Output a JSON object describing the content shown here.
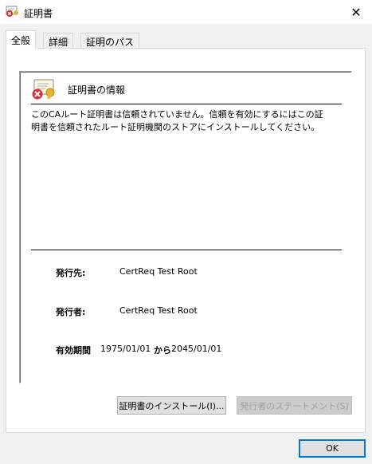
{
  "window": {
    "title": "証明書",
    "close_icon": "close-icon"
  },
  "tabs": [
    {
      "label": "全般",
      "active": true
    },
    {
      "label": "詳細",
      "active": false
    },
    {
      "label": "証明のパス",
      "active": false
    }
  ],
  "general": {
    "section_title": "証明書の情報",
    "warning_lines": [
      "このCAルート証明書は信頼されていません。信頼を有効にするにはこの証",
      "明書を信頼されたルート証明機関のストアにインストールしてください。"
    ],
    "issued_to_label": "発行先:",
    "issued_to_value": "CertReq Test Root",
    "issued_by_label": "発行者:",
    "issued_by_value": "CertReq Test Root",
    "validity_label": "有効期間",
    "valid_from": "1975/01/01",
    "validity_connector": "から",
    "valid_to": "2045/01/01",
    "install_button": "証明書のインストール(I)...",
    "issuer_statement_button": "発行者のステートメント(S)",
    "issuer_statement_enabled": false
  },
  "footer": {
    "ok_button": "OK"
  },
  "colors": {
    "error_red": "#d13438",
    "ribbon_gold": "#e8b33a",
    "focus_blue": "#0078d7"
  }
}
